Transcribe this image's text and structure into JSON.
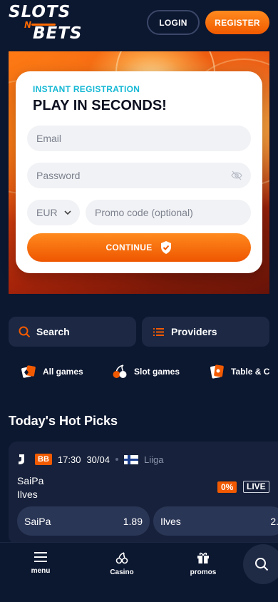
{
  "header": {
    "logo_line1": "SLOTS",
    "logo_line2": "N",
    "logo_line3": "BETS",
    "login_label": "LOGIN",
    "register_label": "REGISTER"
  },
  "form": {
    "kicker": "INSTANT REGISTRATION",
    "title": "PLAY IN SECONDS!",
    "email_placeholder": "Email",
    "password_placeholder": "Password",
    "currency": "EUR",
    "promo_placeholder": "Promo code (optional)",
    "continue_label": "CONTINUE"
  },
  "quick": {
    "search_label": "Search",
    "providers_label": "Providers"
  },
  "categories": [
    {
      "label": "All games",
      "icon": "all-games-icon"
    },
    {
      "label": "Slot games",
      "icon": "slot-games-icon"
    },
    {
      "label": "Table & C",
      "icon": "table-games-icon"
    }
  ],
  "hot_picks": {
    "title": "Today's Hot Picks",
    "match": {
      "badge": "BB",
      "time": "17:30",
      "date": "30/04",
      "league": "Liiga",
      "home": "SaiPa",
      "away": "Ilves",
      "percent": "0%",
      "live": "LIVE",
      "odds": [
        {
          "team": "SaiPa",
          "value": "1.89"
        },
        {
          "team": "Ilves",
          "value": "2."
        }
      ]
    }
  },
  "nav": {
    "menu_label": "menu",
    "casino_label": "Casino",
    "promos_label": "promos"
  },
  "colors": {
    "background": "#0c1730",
    "accent": "#f15a00",
    "card": "#17213b",
    "kicker": "#16b8d4"
  }
}
